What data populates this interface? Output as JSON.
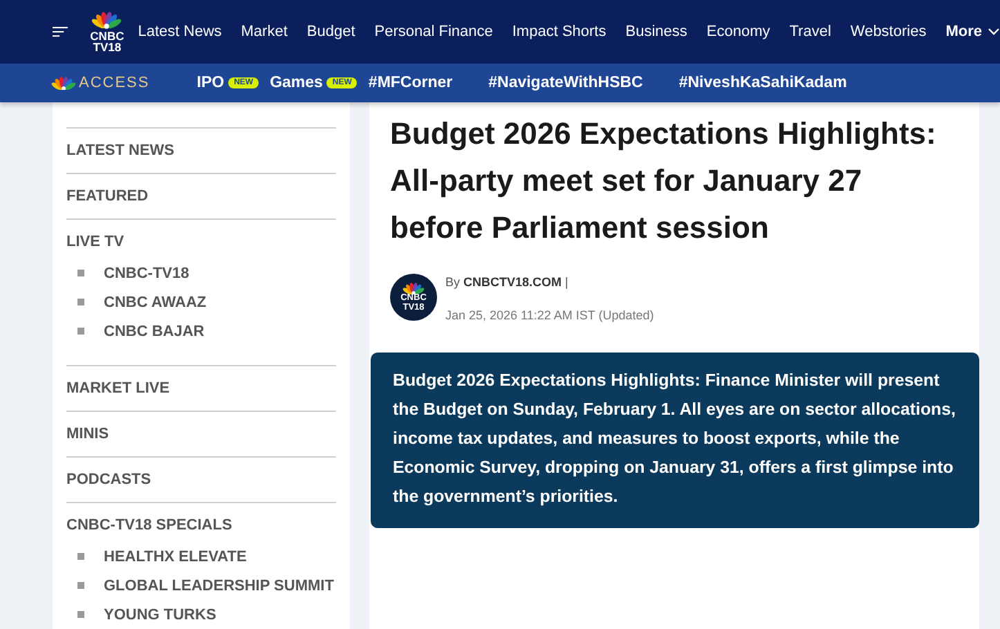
{
  "header": {
    "logo": {
      "line1": "CNBC",
      "line2": "TV18"
    },
    "nav": [
      "Latest News",
      "Market",
      "Budget",
      "Personal Finance",
      "Impact Shorts",
      "Business",
      "Economy",
      "Travel",
      "Webstories"
    ],
    "more": "More"
  },
  "subbar": {
    "logo_text": "ACCESS",
    "links": [
      {
        "label": "IPO",
        "badge": "NEW"
      },
      {
        "label": "Games",
        "badge": "NEW"
      },
      {
        "label": "#MFCorner"
      },
      {
        "label": "#NavigateWithHSBC"
      },
      {
        "label": "#NiveshKaSahiKadam"
      }
    ]
  },
  "sidebar": {
    "items": [
      {
        "label": "LATEST NEWS"
      },
      {
        "label": "FEATURED"
      },
      {
        "label": "LIVE TV",
        "children": [
          {
            "label": "CNBC-TV18"
          },
          {
            "label": "CNBC AWAAZ"
          },
          {
            "label": "CNBC BAJAR"
          }
        ]
      },
      {
        "label": "MARKET LIVE"
      },
      {
        "label": "MINIS"
      },
      {
        "label": "PODCASTS"
      },
      {
        "label": "CNBC-TV18 SPECIALS",
        "children": [
          {
            "label": "HEALTHX ELEVATE"
          },
          {
            "label": "GLOBAL LEADERSHIP SUMMIT"
          },
          {
            "label": "YOUNG TURKS"
          }
        ]
      }
    ]
  },
  "article": {
    "title": "Budget 2026 Expectations Highlights: All-party meet set for January 27 before Parliament session",
    "avatar": {
      "line1": "CNBC",
      "line2": "TV18"
    },
    "author_prefix": "By",
    "author": "CNBCTV18.COM",
    "separator": "|",
    "date": "Jan 25, 2026 11:22 AM IST (Updated)",
    "summary": "Budget 2026 Expectations Highlights: Finance Minister will present the Budget on Sunday, February 1. All eyes are on sector allocations, income tax updates, and measures to boost exports, while the Economic Survey, dropping on January 31, offers a first glimpse into the government’s priorities."
  }
}
